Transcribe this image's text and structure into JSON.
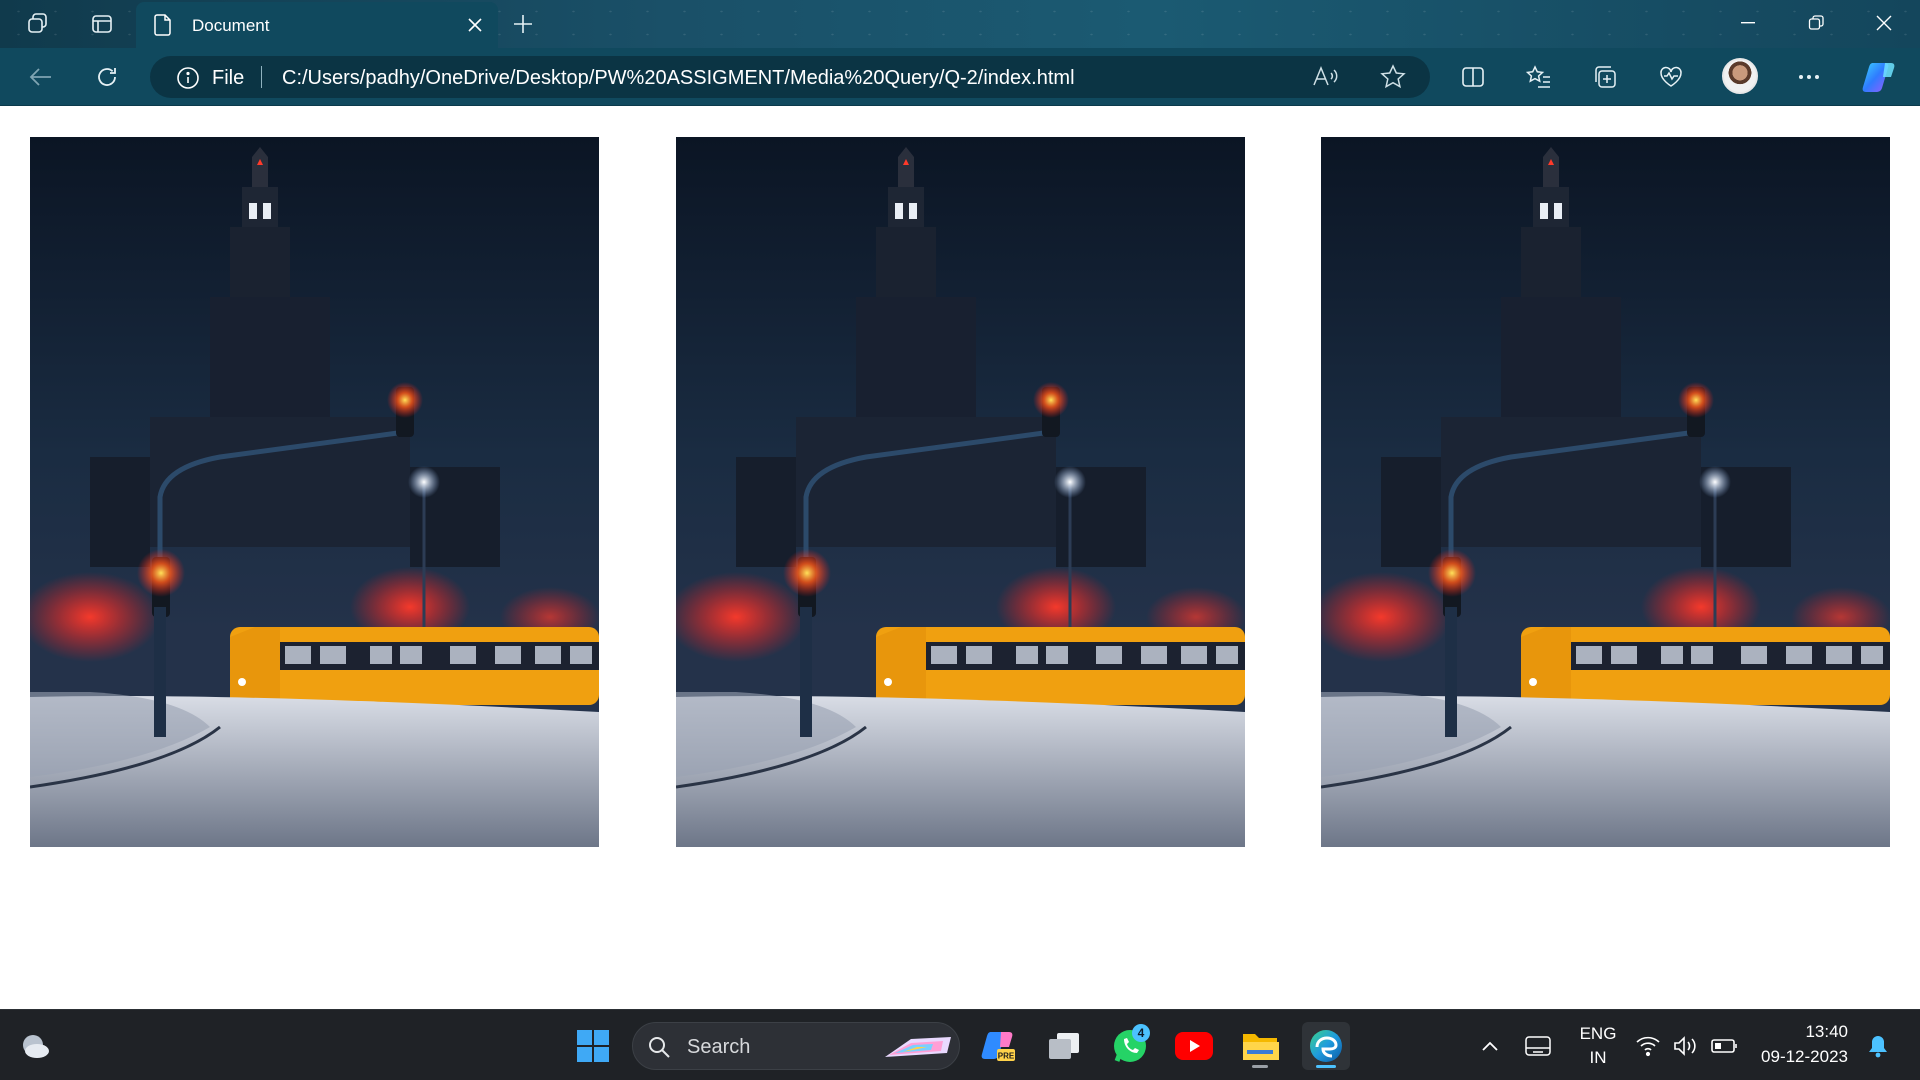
{
  "browser": {
    "tab": {
      "title": "Document"
    },
    "address": {
      "scheme_label": "File",
      "url": "C:/Users/padhy/OneDrive/Desktop/PW%20ASSIGMENT/Media%20Query/Q-2/index.html"
    },
    "accent_color": "#10495e"
  },
  "page": {
    "images": [
      {
        "name": "city-night-tram-image-1"
      },
      {
        "name": "city-night-tram-image-2"
      },
      {
        "name": "city-night-tram-image-3"
      }
    ]
  },
  "taskbar": {
    "search_label": "Search",
    "whatsapp_badge": "4",
    "language_line1": "ENG",
    "language_line2": "IN",
    "time": "13:40",
    "date": "09-12-2023"
  }
}
